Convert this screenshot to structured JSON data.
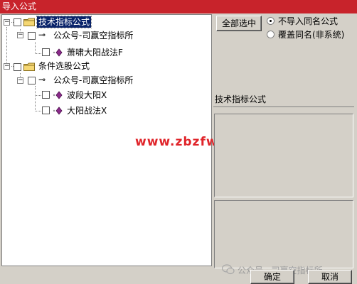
{
  "window": {
    "title": "导入公式"
  },
  "tree": {
    "nodes": [
      {
        "label": "技术指标公式",
        "icon": "folder-icon",
        "selected": true
      },
      {
        "label": "公众号-司赢空指标所",
        "icon": "key-icon"
      },
      {
        "label": "萧啸大阳战法F",
        "icon": "formula-diamond-icon"
      },
      {
        "label": "条件选股公式",
        "icon": "folder-icon"
      },
      {
        "label": "公众号-司赢空指标所",
        "icon": "key-icon"
      },
      {
        "label": "波段大阳X",
        "icon": "formula-diamond-icon"
      },
      {
        "label": "大阳战法X",
        "icon": "formula-diamond-icon"
      }
    ]
  },
  "overlay_watermark": "www.zbzfwu.com",
  "right_panel": {
    "select_all_button": "全部选中",
    "options": [
      {
        "label": "不导入同名公式",
        "checked": true
      },
      {
        "label": "覆盖同名(非系统)",
        "checked": false
      }
    ],
    "section_label": "技术指标公式"
  },
  "footer": {
    "watermark": "公众号 · 司赢空指标所",
    "ok_button": "确定",
    "cancel_button": "取消"
  },
  "colors": {
    "titlebar": "#c8232b",
    "selection": "#0a246a",
    "watermark": "#e0242a",
    "diamond": "#8b2a8b"
  }
}
